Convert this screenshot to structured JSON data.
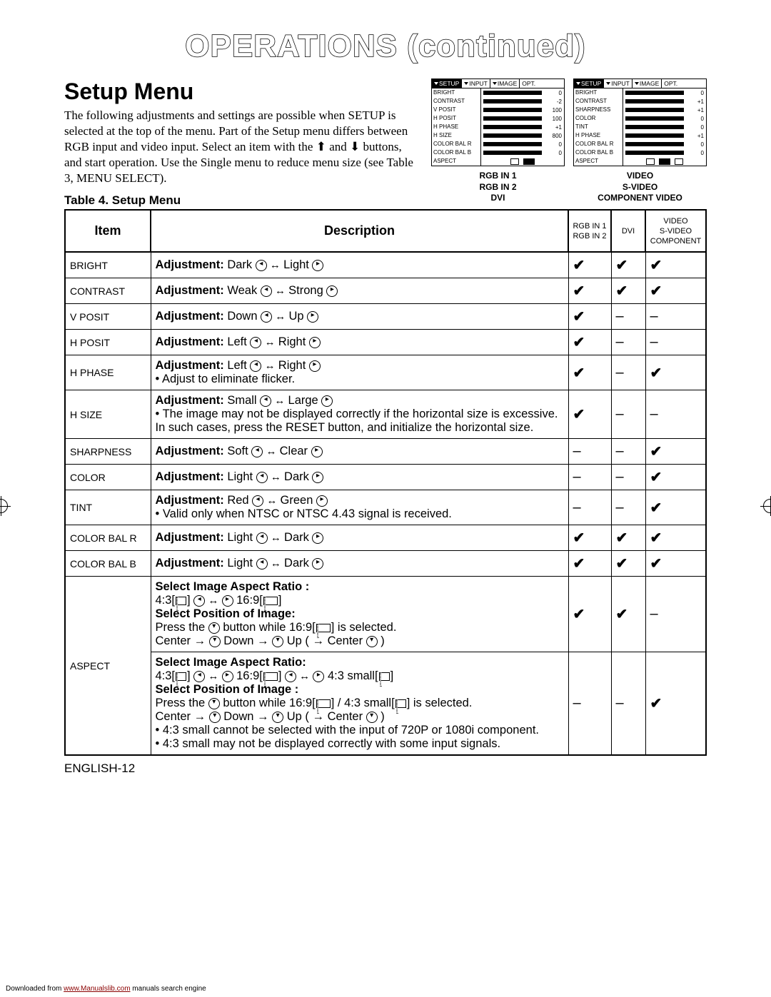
{
  "page_title": "OPERATIONS (continued)",
  "setup_heading": "Setup Menu",
  "intro_text": "The following adjustments and settings are possible when SETUP is selected at the top of the menu. Part of the Setup menu differs between RGB input and video input. Select an item with the ⬆ and ⬇ buttons, and start operation. Use the Single menu to reduce menu size (see Table 3, MENU SELECT).",
  "table_title": "Table 4. Setup Menu",
  "osd_tabs": [
    "SETUP",
    "INPUT",
    "IMAGE",
    "OPT."
  ],
  "osd_left": {
    "labels": [
      "BRIGHT",
      "CONTRAST",
      "V POSIT",
      "H POSIT",
      "H PHASE",
      "H SIZE",
      "COLOR BAL R",
      "COLOR BAL B",
      "ASPECT"
    ],
    "values": [
      "0",
      "-2",
      "100",
      "100",
      "+1",
      "800",
      "0",
      "0",
      ""
    ]
  },
  "osd_right": {
    "labels": [
      "BRIGHT",
      "CONTRAST",
      "SHARPNESS",
      "COLOR",
      "TINT",
      "H PHASE",
      "COLOR BAL R",
      "COLOR BAL B",
      "ASPECT"
    ],
    "values": [
      "0",
      "+1",
      "+1",
      "0",
      "0",
      "+1",
      "0",
      "0",
      ""
    ]
  },
  "osd_caption_left": "RGB IN 1\nRGB IN 2\nDVI",
  "osd_caption_right": "VIDEO\nS-VIDEO\nCOMPONENT VIDEO",
  "columns": {
    "item": "Item",
    "desc": "Description",
    "c1": "RGB IN 1\nRGB IN 2",
    "c2": "DVI",
    "c3": "VIDEO\nS-VIDEO\nCOMPONENT"
  },
  "rows": [
    {
      "item": "BRIGHT",
      "desc_label": "Adjustment:",
      "desc_a": "Dark",
      "desc_b": "Light",
      "c": [
        true,
        true,
        true
      ]
    },
    {
      "item": "CONTRAST",
      "desc_label": "Adjustment:",
      "desc_a": "Weak",
      "desc_b": "Strong",
      "c": [
        true,
        true,
        true
      ]
    },
    {
      "item": "V POSIT",
      "desc_label": "Adjustment:",
      "desc_a": "Down",
      "desc_b": "Up",
      "c": [
        true,
        false,
        false
      ]
    },
    {
      "item": "H POSIT",
      "desc_label": "Adjustment:",
      "desc_a": "Left",
      "desc_b": "Right",
      "c": [
        true,
        false,
        false
      ]
    },
    {
      "item": "H PHASE",
      "desc_label": "Adjustment:",
      "desc_a": "Left",
      "desc_b": "Right",
      "note": "• Adjust to eliminate flicker.",
      "c": [
        true,
        false,
        true
      ]
    },
    {
      "item": "H SIZE",
      "desc_label": "Adjustment:",
      "desc_a": "Small",
      "desc_b": "Large",
      "note": "• The image may not be displayed correctly if the horizontal size is excessive. In such cases, press the RESET button, and initialize the horizontal size.",
      "c": [
        true,
        false,
        false
      ]
    },
    {
      "item": "SHARPNESS",
      "desc_label": "Adjustment:",
      "desc_a": "Soft",
      "desc_b": "Clear",
      "c": [
        false,
        false,
        true
      ]
    },
    {
      "item": "COLOR",
      "desc_label": "Adjustment:",
      "desc_a": "Light",
      "desc_b": "Dark",
      "c": [
        false,
        false,
        true
      ]
    },
    {
      "item": "TINT",
      "desc_label": "Adjustment:",
      "desc_a": "Red",
      "desc_b": "Green",
      "note": "• Valid only when NTSC or NTSC 4.43 signal is received.",
      "c": [
        false,
        false,
        true
      ]
    },
    {
      "item": "COLOR BAL R",
      "desc_label": "Adjustment:",
      "desc_a": "Light",
      "desc_b": "Dark",
      "c": [
        true,
        true,
        true
      ]
    },
    {
      "item": "COLOR BAL B",
      "desc_label": "Adjustment:",
      "desc_a": "Light",
      "desc_b": "Dark",
      "c": [
        true,
        true,
        true
      ]
    }
  ],
  "aspect": {
    "item": "ASPECT",
    "block1": {
      "h1": "Select Image Aspect Ratio :",
      "line1_a": "4:3[",
      "line1_b": "] ",
      "line1_c": " 16:9[",
      "line1_d": "]",
      "h2": "Select Position of Image:",
      "line2_a": "Press the ",
      "line2_b": " button while 16:9[",
      "line2_c": "] is selected.",
      "line3_a": "Center → ",
      "line3_b": " Down → ",
      "line3_c": " Up ( → Center ",
      "line3_d": " )",
      "c": [
        true,
        true,
        false
      ]
    },
    "block2": {
      "h1": "Select Image Aspect Ratio:",
      "line1_a": "4:3[",
      "line1_b": "] ",
      "line1_c": " 16:9[",
      "line1_d": "] ",
      "line1_e": " 4:3 small[",
      "line1_f": "]",
      "h2": "Select Position of Image :",
      "line2_a": "Press the ",
      "line2_b": " button while 16:9[",
      "line2_c": "] / 4:3 small[",
      "line2_d": "] is selected.",
      "line3_a": "Center → ",
      "line3_b": " Down → ",
      "line3_c": " Up ( → Center ",
      "line3_d": " )",
      "n1": "• 4:3 small cannot be selected with the input of 720P or 1080i component.",
      "n2": "• 4:3 small may not be displayed correctly with some input signals.",
      "c": [
        false,
        false,
        true
      ]
    }
  },
  "footer": "ENGLISH-12",
  "download": {
    "pre": "Downloaded from ",
    "link": "www.Manualslib.com",
    "post": " manuals search engine"
  }
}
